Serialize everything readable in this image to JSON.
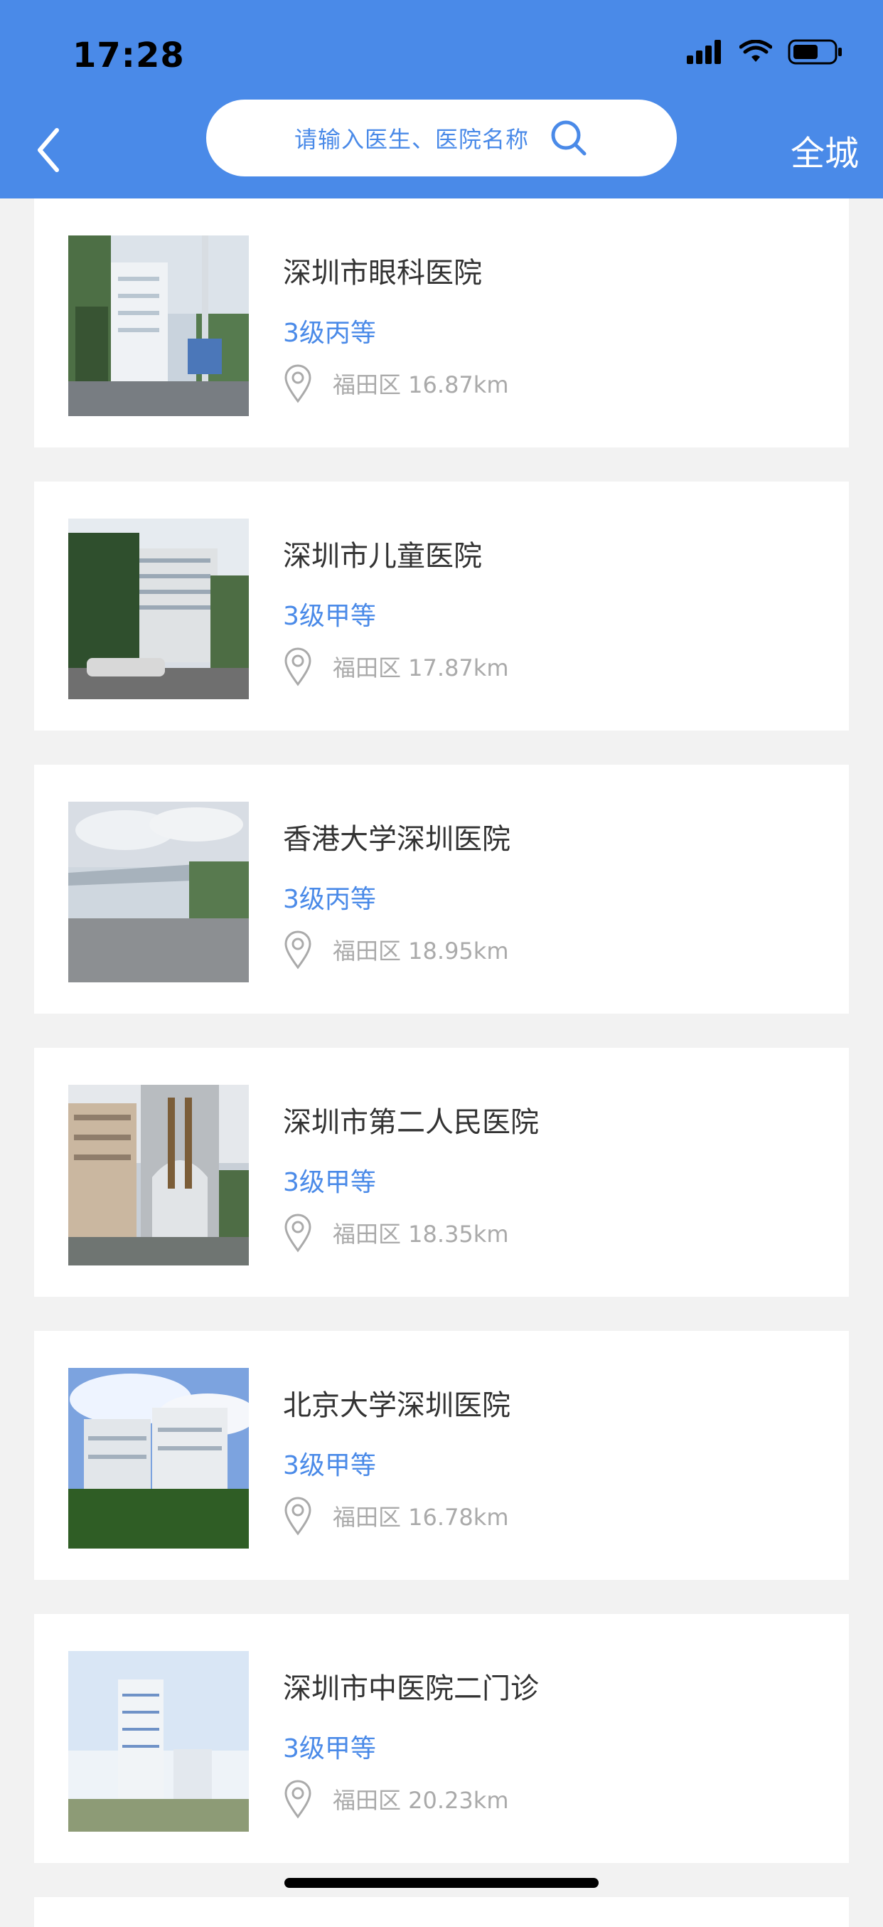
{
  "status_bar": {
    "time": "17:28"
  },
  "header": {
    "search_placeholder": "请输入医生、医院名称",
    "city_label": "全城"
  },
  "hospitals": [
    {
      "name": "深圳市眼科医院",
      "level": "3级丙等",
      "location": "福田区 16.87km"
    },
    {
      "name": "深圳市儿童医院",
      "level": "3级甲等",
      "location": "福田区 17.87km"
    },
    {
      "name": "香港大学深圳医院",
      "level": "3级丙等",
      "location": "福田区 18.95km"
    },
    {
      "name": "深圳市第二人民医院",
      "level": "3级甲等",
      "location": "福田区 18.35km"
    },
    {
      "name": "北京大学深圳医院",
      "level": "3级甲等",
      "location": "福田区 16.78km"
    },
    {
      "name": "深圳市中医院二门诊",
      "level": "3级甲等",
      "location": "福田区 20.23km"
    }
  ],
  "icons": {
    "signal": "cellular-signal-icon",
    "wifi": "wifi-icon",
    "battery": "battery-icon",
    "back": "chevron-left-icon",
    "search": "search-icon",
    "location": "location-pin-icon"
  },
  "colors": {
    "header_blue": "#4a8ae8",
    "link_blue": "#4a8ae8",
    "muted_gray": "#aaaaaa",
    "page_background": "#f2f2f2"
  }
}
